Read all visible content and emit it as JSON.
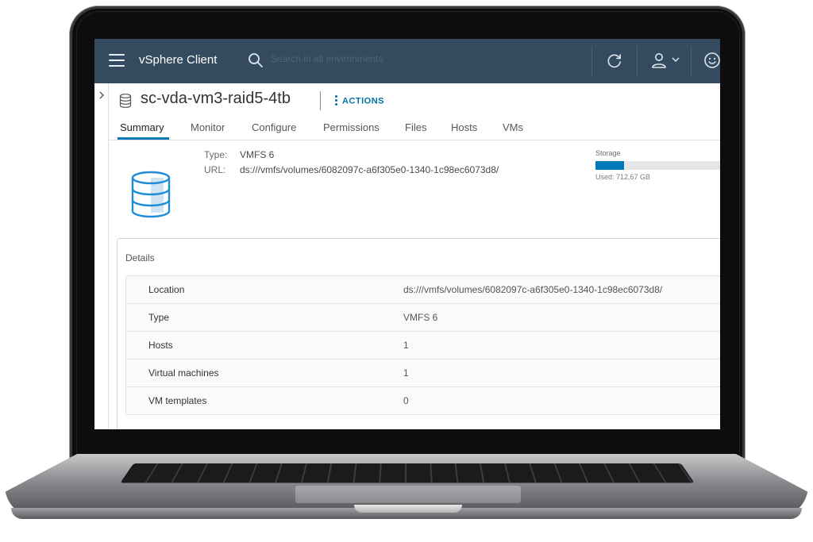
{
  "app": {
    "title": "vSphere Client",
    "search_placeholder": "Search in all environments"
  },
  "object": {
    "name": "sc-vda-vm3-raid5-4tb",
    "actions_label": "ACTIONS"
  },
  "tabs": [
    {
      "label": "Summary",
      "active": true
    },
    {
      "label": "Monitor",
      "active": false
    },
    {
      "label": "Configure",
      "active": false
    },
    {
      "label": "Permissions",
      "active": false
    },
    {
      "label": "Files",
      "active": false
    },
    {
      "label": "Hosts",
      "active": false
    },
    {
      "label": "VMs",
      "active": false
    }
  ],
  "summary": {
    "type_label": "Type:",
    "type_value": "VMFS 6",
    "url_label": "URL:",
    "url_value": "ds:///vmfs/volumes/6082097c-a6f305e0-1340-1c98ec6073d8/"
  },
  "storage": {
    "label": "Storage",
    "used_text": "Used: 712.67 GB",
    "used_fraction": 0.23
  },
  "details": {
    "title": "Details",
    "rows": [
      {
        "key": "Location",
        "value": "ds:///vmfs/volumes/6082097c-a6f305e0-1340-1c98ec6073d8/"
      },
      {
        "key": "Type",
        "value": "VMFS 6"
      },
      {
        "key": "Hosts",
        "value": "1"
      },
      {
        "key": "Virtual machines",
        "value": "1"
      },
      {
        "key": "VM templates",
        "value": "0"
      }
    ]
  },
  "icons": {
    "menu": "hamburger-menu-icon",
    "search": "search-icon",
    "refresh": "refresh-icon",
    "user": "user-icon",
    "feedback": "smiley-icon",
    "datastore": "datastore-icon"
  },
  "colors": {
    "header_bg": "#344a5e",
    "accent": "#0079b8",
    "link": "#0072a3"
  }
}
